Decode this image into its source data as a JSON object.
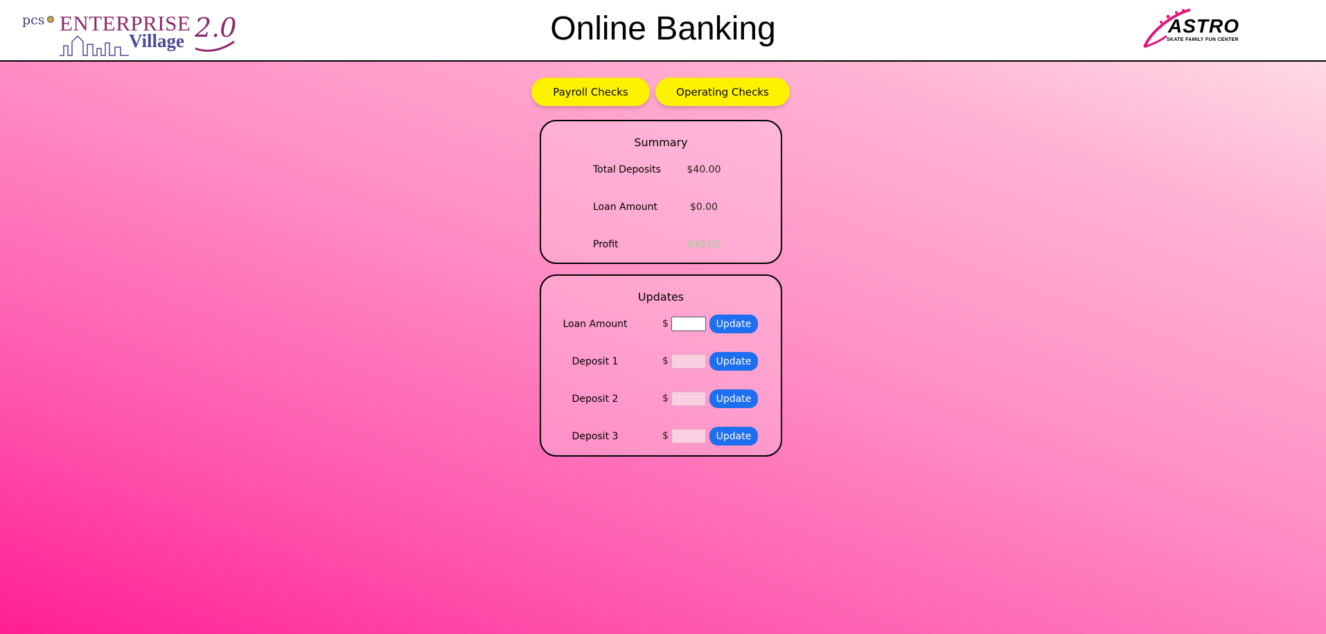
{
  "header": {
    "left_logo": {
      "pcs": "pcs",
      "enterprise": "ENTERPRISE",
      "village": "Village",
      "version": "2.0"
    },
    "title": "Online Banking",
    "right_logo": {
      "name": "ASTRO",
      "tagline": "SKATE FAMILY FUN CENTER"
    }
  },
  "nav": {
    "payroll_label": "Payroll Checks",
    "operating_label": "Operating Checks"
  },
  "summary": {
    "title": "Summary",
    "rows": [
      {
        "label": "Total Deposits",
        "value": "$40.00"
      },
      {
        "label": "Loan Amount",
        "value": "$0.00"
      },
      {
        "label": "Profit",
        "value": "$40.00"
      }
    ]
  },
  "updates": {
    "title": "Updates",
    "currency_symbol": "$",
    "rows": [
      {
        "label": "Loan Amount",
        "value": "",
        "button": "Update"
      },
      {
        "label": "Deposit 1",
        "value": "",
        "button": "Update"
      },
      {
        "label": "Deposit 2",
        "value": "",
        "button": "Update"
      },
      {
        "label": "Deposit 3",
        "value": "",
        "button": "Update"
      }
    ]
  },
  "colors": {
    "accent_yellow": "#fff200",
    "update_button_blue": "#1e6ef0",
    "profit_green": "#8fd88f",
    "brand_plum": "#8a2a6b",
    "brand_indigo": "#4a4a9a",
    "astro_magenta": "#e0157a"
  }
}
